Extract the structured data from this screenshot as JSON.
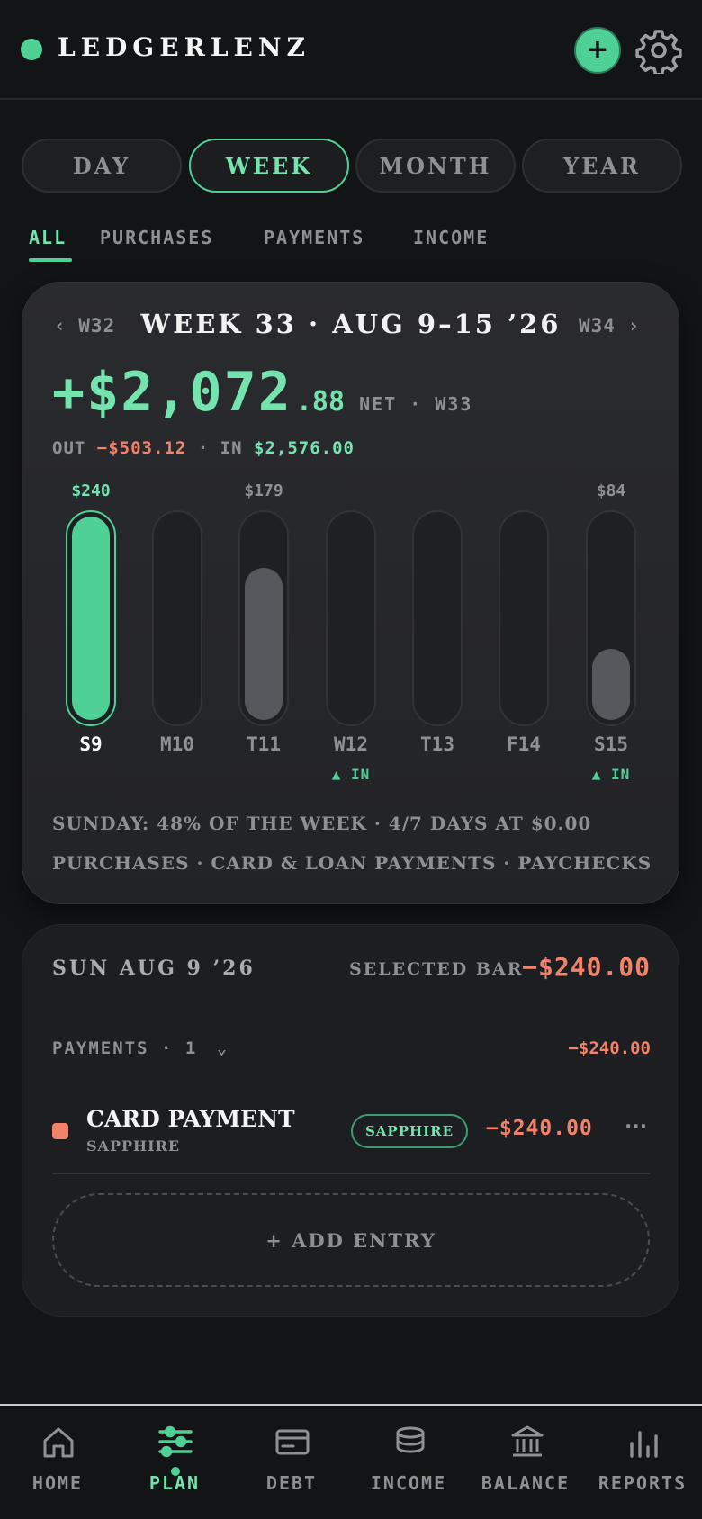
{
  "app": {
    "name": "LEDGERLENZ",
    "status_color": "#4fd195"
  },
  "header": {
    "add_label": "+",
    "settings_icon": "gear-icon"
  },
  "periods": [
    {
      "label": "DAY",
      "active": false
    },
    {
      "label": "WEEK",
      "active": true
    },
    {
      "label": "MONTH",
      "active": false
    },
    {
      "label": "YEAR",
      "active": false
    }
  ],
  "filters": [
    {
      "label": "ALL",
      "active": true
    },
    {
      "label": "PURCHASES",
      "active": false
    },
    {
      "label": "PAYMENTS",
      "active": false
    },
    {
      "label": "INCOME",
      "active": false
    }
  ],
  "week_card": {
    "prev": "‹ W32",
    "next": "W34 ›",
    "title": "WEEK 33 · AUG 9–15 ’26",
    "net_main": "+$2,072",
    "net_cents": ".88",
    "net_label": "NET · W33",
    "out_label": "OUT",
    "out_value": "−$503.12",
    "sep": "·",
    "in_label": "IN",
    "in_value": "$2,576.00",
    "note_1": "SUNDAY: 48% OF THE WEEK · 4/7 DAYS AT $0.00",
    "note_2": "PURCHASES · CARD & LOAN PAYMENTS · PAYCHECKS"
  },
  "chart_data": {
    "type": "bar",
    "categories": [
      "S9",
      "M10",
      "T11",
      "W12",
      "T13",
      "F14",
      "S15"
    ],
    "values": [
      240,
      0,
      179,
      0,
      0,
      0,
      84
    ],
    "value_labels": [
      "$240",
      "",
      "$179",
      "",
      "",
      "",
      "$84"
    ],
    "income_markers": [
      "",
      "",
      "",
      "▲ IN",
      "",
      "",
      "▲ IN"
    ],
    "selected_index": 0,
    "ylim": [
      0,
      240
    ]
  },
  "detail": {
    "date": "SUN AUG 9 ’26",
    "selected_label": "SELECTED BAR",
    "selected_amount": "−$240.00",
    "group_label": "PAYMENTS · 1",
    "group_chevron": "⌄",
    "group_amount": "−$240.00",
    "transaction": {
      "name": "CARD PAYMENT",
      "account": "SAPPHIRE",
      "tag": "SAPPHIRE",
      "amount": "−$240.00",
      "more": "···",
      "color": "#f2836a"
    },
    "add_entry": "+ ADD ENTRY"
  },
  "bottom_nav": [
    {
      "label": "HOME",
      "icon": "home-icon",
      "active": false
    },
    {
      "label": "PLAN",
      "icon": "sliders-icon",
      "active": true
    },
    {
      "label": "DEBT",
      "icon": "card-icon",
      "active": false
    },
    {
      "label": "INCOME",
      "icon": "coins-icon",
      "active": false
    },
    {
      "label": "BALANCE",
      "icon": "bank-icon",
      "active": false
    },
    {
      "label": "REPORTS",
      "icon": "bar-chart-icon",
      "active": false
    }
  ]
}
